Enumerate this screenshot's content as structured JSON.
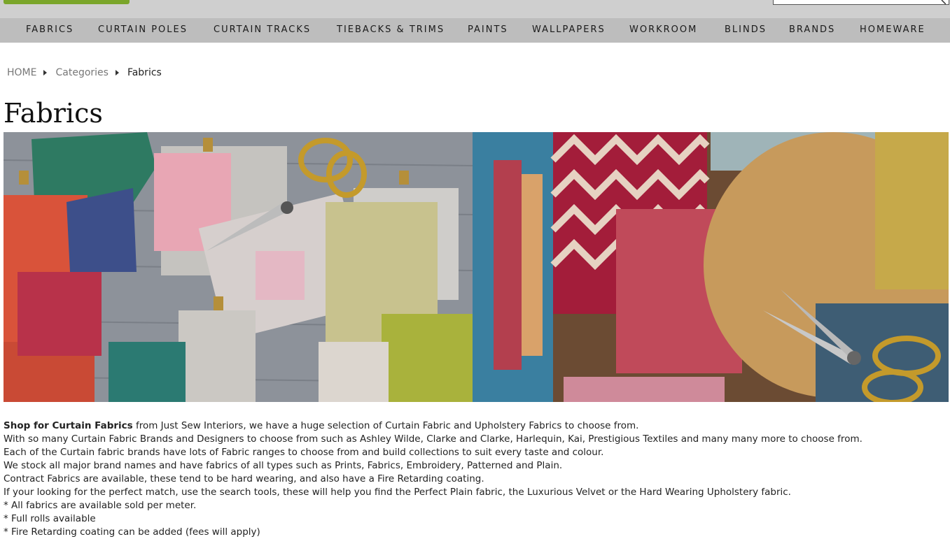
{
  "nav": {
    "items": [
      {
        "label": "FABRICS"
      },
      {
        "label": "CURTAIN POLES"
      },
      {
        "label": "CURTAIN TRACKS"
      },
      {
        "label": "TIEBACKS & TRIMS"
      },
      {
        "label": "PAINTS"
      },
      {
        "label": "WALLPAPERS"
      },
      {
        "label": "WORKROOM"
      },
      {
        "label": "BLINDS"
      },
      {
        "label": "BRANDS"
      },
      {
        "label": "HOMEWARE"
      }
    ]
  },
  "breadcrumb": {
    "home": "HOME",
    "categories": "Categories",
    "current": "Fabrics"
  },
  "page": {
    "title": "Fabrics"
  },
  "banner": {
    "icon": "fabric-swatches-photo"
  },
  "description": {
    "lead_bold": "Shop for Curtain Fabrics",
    "lead_rest": " from Just Sew Interiors, we have a huge selection of Curtain Fabric and Upholstery Fabrics to choose from.",
    "lines": [
      "With so many Curtain Fabric  Brands and Designers to choose from such as Ashley Wilde, Clarke and Clarke, Harlequin, Kai, Prestigious Textiles and many many more to choose from.",
      "Each of the Curtain fabric brands have lots of Fabric ranges to choose from and build collections to suit every taste and colour.",
      "We stock all major brand names and have fabrics of all types such as Prints, Fabrics, Embroidery, Patterned and Plain.",
      "Contract Fabrics are available, these tend to be hard wearing, and also have a Fire Retarding coating.",
      "If your looking for the perfect match, use the search tools, these will help you find the Perfect Plain fabric, the Luxurious Velvet or the Hard Wearing Upholstery fabric.",
      "* All fabrics are available sold per meter.",
      "* Full rolls available",
      "* Fire Retarding coating can be added (fees will apply)"
    ]
  },
  "colors": {
    "accent_green": "#7aa52a",
    "nav_bg": "#bdbdbd",
    "topbar_bg": "#cfcfcf"
  }
}
